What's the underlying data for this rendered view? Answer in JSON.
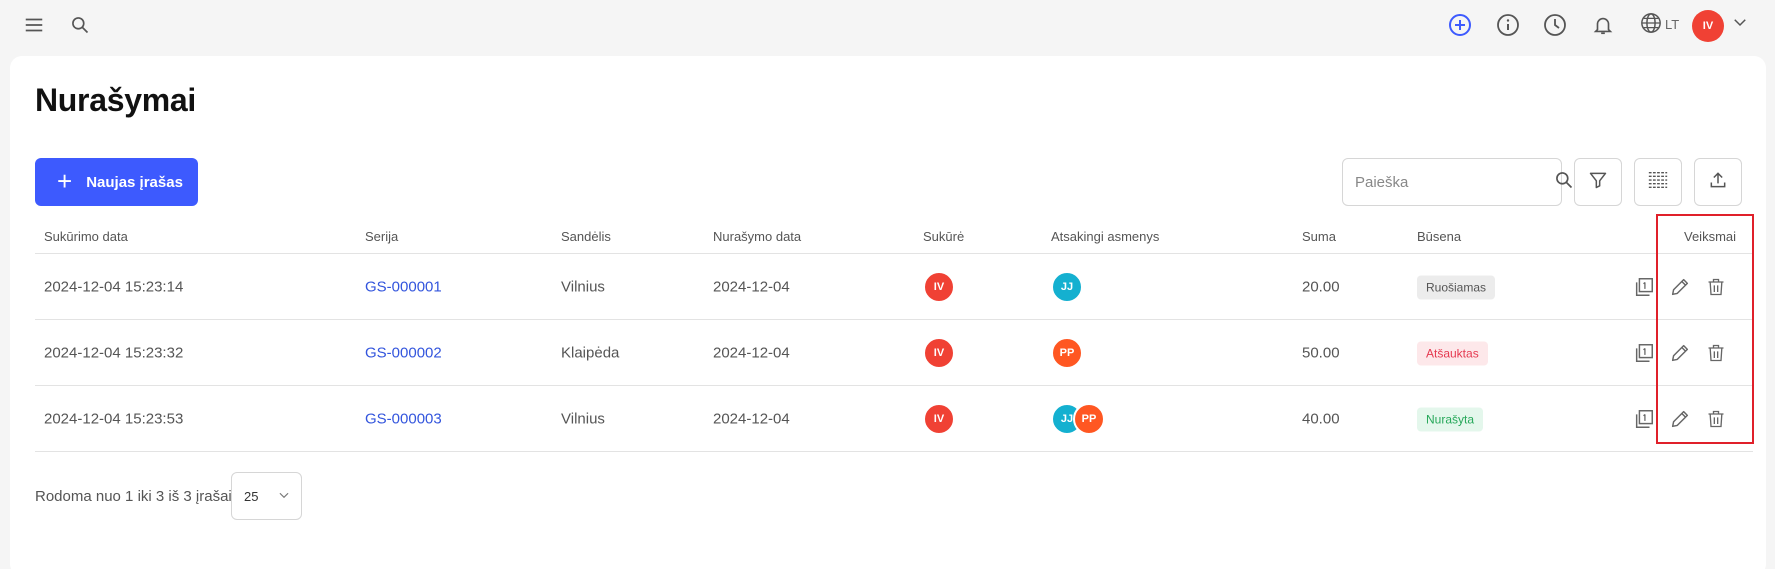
{
  "page": {
    "title": "Nurašymai"
  },
  "topbar": {
    "language": "LT",
    "user_initials": "IV",
    "icons": [
      "menu-icon",
      "search-icon",
      "add-circle-icon",
      "info-icon",
      "clock-icon",
      "bell-icon",
      "globe-icon",
      "chevron-down-icon"
    ],
    "accent": "#3d5afe"
  },
  "toolbar": {
    "new_label": "Naujas įrašas",
    "search_placeholder": "Paieška"
  },
  "table": {
    "columns": [
      "Sukūrimo data",
      "Serija",
      "Sandėlis",
      "Nurašymo data",
      "Sukūrė",
      "Atsakingi asmenys",
      "Suma",
      "Būsena",
      "Veiksmai"
    ],
    "rows": [
      {
        "created": "2024-12-04 15:23:14",
        "series": "GS-000001",
        "warehouse": "Vilnius",
        "writeoff_date": "2024-12-04",
        "creator": "IV",
        "responsible": [
          "JJ"
        ],
        "sum": "20.00",
        "status": "Ruošiamas",
        "status_bg": "#ececec",
        "status_fg": "#555555"
      },
      {
        "created": "2024-12-04 15:23:32",
        "series": "GS-000002",
        "warehouse": "Klaipėda",
        "writeoff_date": "2024-12-04",
        "creator": "IV",
        "responsible": [
          "PP"
        ],
        "sum": "50.00",
        "status": "Atšauktas",
        "status_bg": "#fde8ea",
        "status_fg": "#e53950"
      },
      {
        "created": "2024-12-04 15:23:53",
        "series": "GS-000003",
        "warehouse": "Vilnius",
        "writeoff_date": "2024-12-04",
        "creator": "IV",
        "responsible": [
          "JJ",
          "PP"
        ],
        "sum": "40.00",
        "status": "Nurašyta",
        "status_bg": "#e4f7ec",
        "status_fg": "#27a85a"
      }
    ]
  },
  "pagination": {
    "summary": "Rodoma nuo 1 iki 3 iš 3 įrašai",
    "page_size": "25"
  },
  "colors": {
    "red": "#f04134",
    "cyan": "#14b0d0",
    "orange": "#ff5722",
    "link": "#3355dd"
  }
}
